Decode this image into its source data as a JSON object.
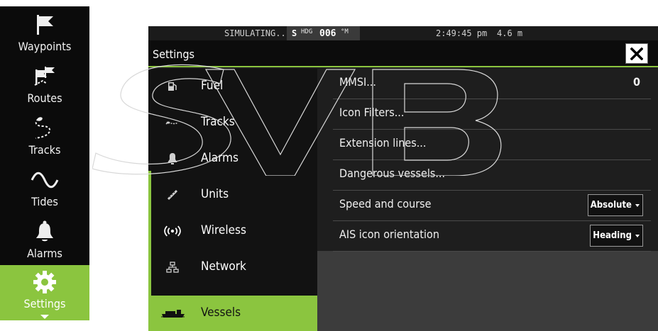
{
  "leftbar": {
    "items": [
      {
        "label": "Waypoints",
        "icon": "flag-icon"
      },
      {
        "label": "Routes",
        "icon": "route-flag-icon"
      },
      {
        "label": "Tracks",
        "icon": "tracks-icon"
      },
      {
        "label": "Tides",
        "icon": "wave-icon"
      },
      {
        "label": "Alarms",
        "icon": "bell-icon"
      },
      {
        "label": "Settings",
        "icon": "gear-icon"
      }
    ],
    "active": "Settings"
  },
  "status": {
    "simulating": "SIMULATING...",
    "hdg_prefix": "S",
    "hdg_label": "HDG",
    "hdg_value": "006",
    "hdg_unit": "°M",
    "time": "2:49:45 pm",
    "depth": "4.6 m"
  },
  "dialog": {
    "title": "Settings"
  },
  "menu": {
    "items": [
      {
        "label": "Fuel",
        "icon": "fuel-icon"
      },
      {
        "label": "Tracks",
        "icon": "tracks-icon"
      },
      {
        "label": "Alarms",
        "icon": "bell-icon"
      },
      {
        "label": "Units",
        "icon": "ruler-icon"
      },
      {
        "label": "Wireless",
        "icon": "wireless-icon"
      },
      {
        "label": "Network",
        "icon": "network-icon"
      },
      {
        "label": "Vessels",
        "icon": "vessel-icon"
      }
    ],
    "active": "Vessels"
  },
  "options": [
    {
      "label": "MMSI...",
      "value": "0"
    },
    {
      "label": "Icon Filters..."
    },
    {
      "label": "Extension lines..."
    },
    {
      "label": "Dangerous vessels..."
    },
    {
      "label": "Speed and course",
      "select": "Absolute"
    },
    {
      "label": "AIS icon orientation",
      "select": "Heading"
    }
  ],
  "watermark": "SVB",
  "colors": {
    "accent": "#8bc53f",
    "background": "#1e1e1e",
    "menu_bg": "#121212"
  }
}
